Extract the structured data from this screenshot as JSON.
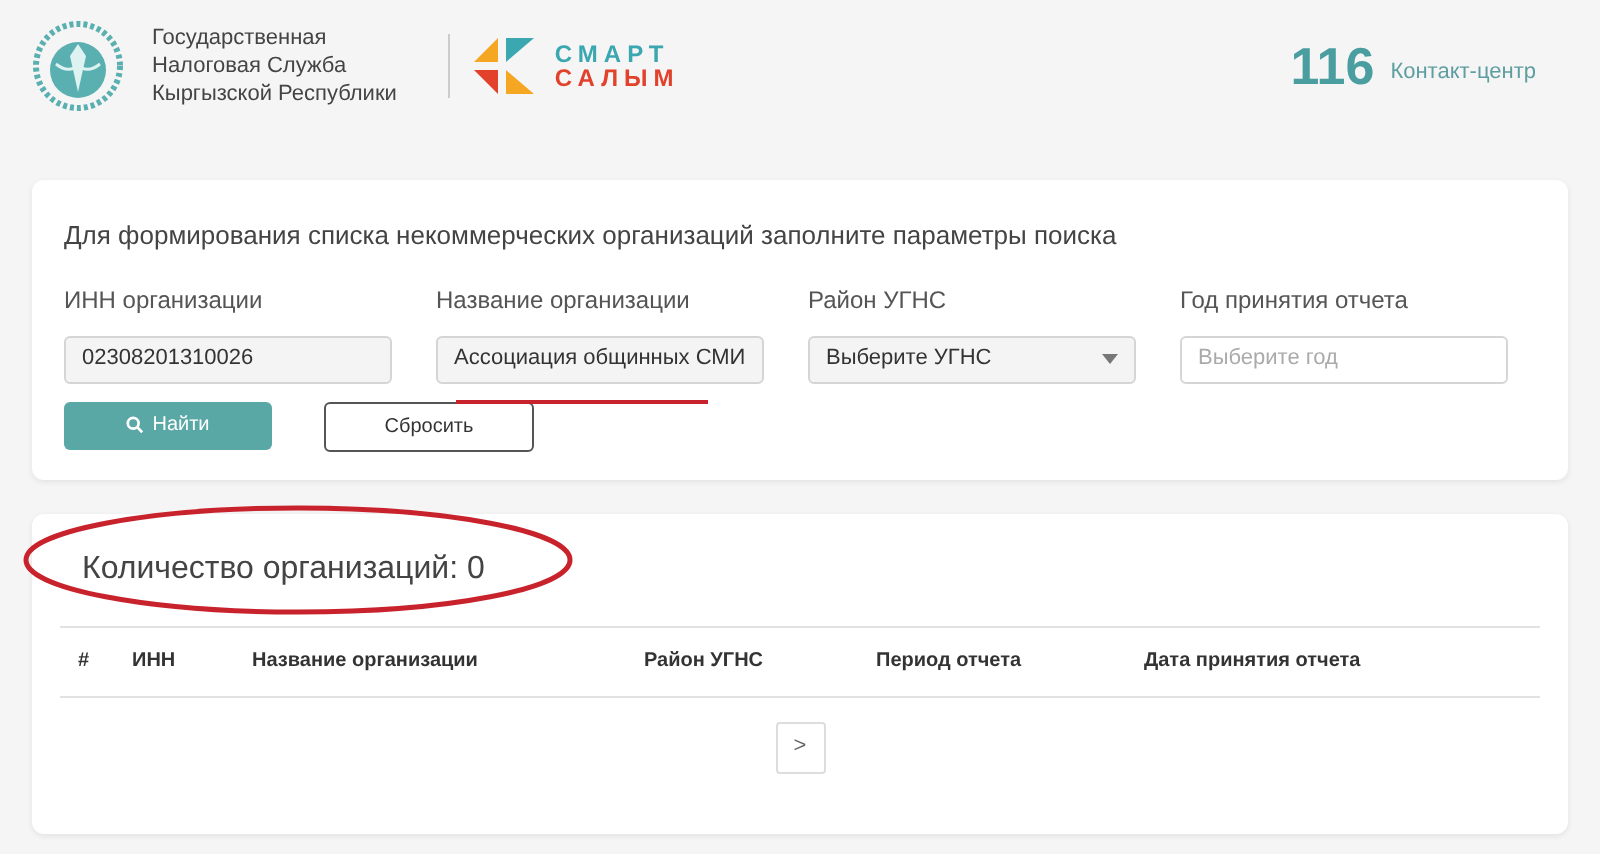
{
  "header": {
    "org_name": [
      "Государственная",
      "Налоговая Служба",
      "Кыргызской Республики"
    ],
    "brand": [
      "СМАРТ",
      "САЛЫМ"
    ],
    "phone": "116",
    "phone_label": "Контакт-центр"
  },
  "search": {
    "title": "Для формирования списка некоммерческих организаций заполните параметры поиска",
    "fields": [
      {
        "kind": "text",
        "label": "ИНН организации",
        "value": "02308201310026",
        "highlighted": false
      },
      {
        "kind": "text",
        "label": "Название организации",
        "value": "Ассоциация общинных СМИ",
        "highlighted": true
      },
      {
        "kind": "select",
        "label": "Район УГНС",
        "value": "Выберите УГНС",
        "highlighted": false
      },
      {
        "kind": "date",
        "label": "Год принятия отчета",
        "placeholder": "Выберите год",
        "highlighted": false
      }
    ],
    "buttons": [
      {
        "kind": "primary",
        "label": "Найти"
      },
      {
        "kind": "outline",
        "label": "Сбросить"
      }
    ]
  },
  "results": {
    "count_text": "Количество организаций: 0",
    "circled": true,
    "table": {
      "columns": [
        "#",
        "ИНН",
        "Название организации",
        "Район УГНС",
        "Период отчета",
        "Дата принятия отчета"
      ]
    },
    "pager": {
      "next": ">"
    }
  }
}
